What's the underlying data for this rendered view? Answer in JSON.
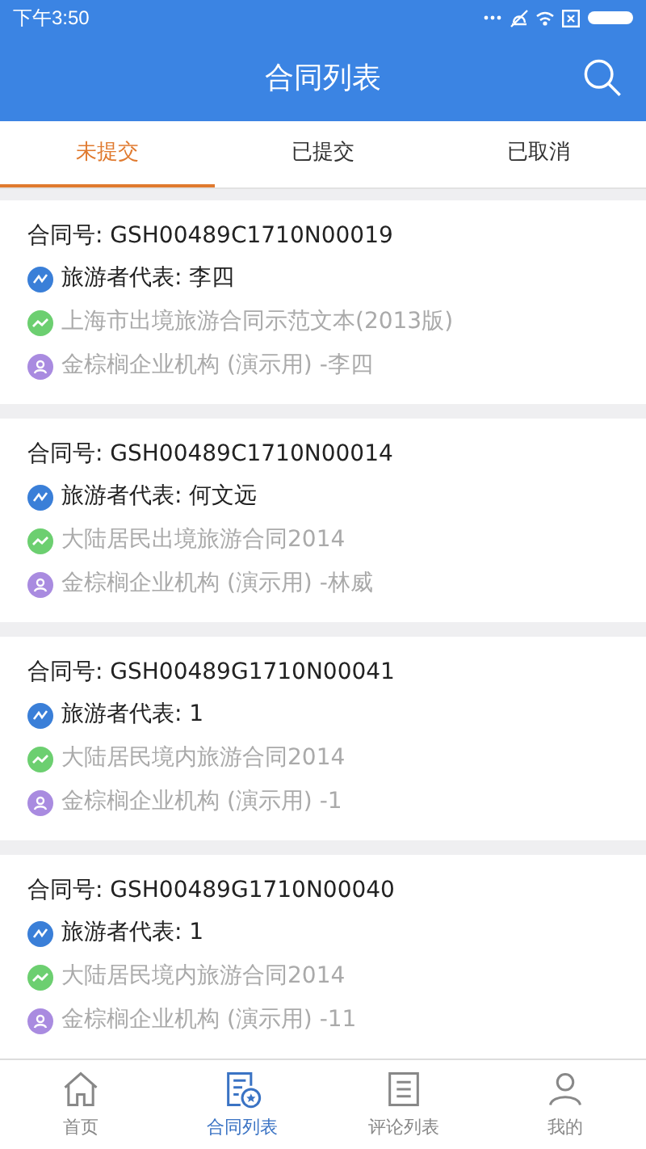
{
  "status_bar": {
    "time": "下午3:50"
  },
  "header": {
    "title": "合同列表"
  },
  "tabs": [
    {
      "label": "未提交",
      "selected": true
    },
    {
      "label": "已提交",
      "selected": false
    },
    {
      "label": "已取消",
      "selected": false
    }
  ],
  "contracts": [
    {
      "number": "合同号: GSH00489C1710N00019",
      "representative": "旅游者代表: 李四",
      "template": "上海市出境旅游合同示范文本(2013版)",
      "agency": "金棕榈企业机构 (演示用) -李四"
    },
    {
      "number": "合同号: GSH00489C1710N00014",
      "representative": "旅游者代表: 何文远",
      "template": "大陆居民出境旅游合同2014",
      "agency": "金棕榈企业机构 (演示用) -林威"
    },
    {
      "number": "合同号: GSH00489G1710N00041",
      "representative": "旅游者代表: 1",
      "template": "大陆居民境内旅游合同2014",
      "agency": "金棕榈企业机构 (演示用) -1"
    },
    {
      "number": "合同号: GSH00489G1710N00040",
      "representative": "旅游者代表: 1",
      "template": "大陆居民境内旅游合同2014",
      "agency": "金棕榈企业机构 (演示用) -11"
    }
  ],
  "bottom_nav": [
    {
      "label": "首页",
      "kind": "home",
      "selected": false
    },
    {
      "label": "合同列表",
      "kind": "contracts",
      "selected": true
    },
    {
      "label": "评论列表",
      "kind": "comments",
      "selected": false
    },
    {
      "label": "我的",
      "kind": "profile",
      "selected": false
    }
  ]
}
